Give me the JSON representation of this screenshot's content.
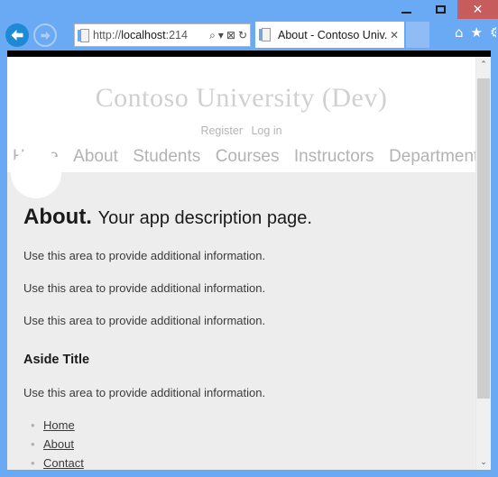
{
  "window": {
    "minimize_label": "Minimize",
    "maximize_label": "Maximize",
    "close_label": "✕"
  },
  "browser": {
    "back_label": "←",
    "forward_label": "→",
    "address": {
      "url_scheme": "http://",
      "url_host": "localhost",
      "url_port": ":214",
      "search_icon": "⌕",
      "dropdown_icon": "▾",
      "compat_icon": "⊠",
      "refresh_icon": "↻"
    },
    "tab": {
      "title": "About - Contoso Univ...",
      "close_label": "✕"
    },
    "toolbar_icons": {
      "home": "⌂",
      "favorites": "★",
      "tools": "⚙"
    }
  },
  "site": {
    "brand": "Contoso University (Dev)",
    "auth_links": [
      {
        "label": "Register"
      },
      {
        "label": "Log in"
      }
    ],
    "nav": [
      {
        "label": "Home"
      },
      {
        "label": "About"
      },
      {
        "label": "Students"
      },
      {
        "label": "Courses"
      },
      {
        "label": "Instructors"
      },
      {
        "label": "Departments"
      }
    ]
  },
  "page": {
    "heading_bold": "About.",
    "heading_sub": "Your app description page.",
    "paragraphs": [
      "Use this area to provide additional information.",
      "Use this area to provide additional information.",
      "Use this area to provide additional information."
    ],
    "aside_title": "Aside Title",
    "aside_text": "Use this area to provide additional information.",
    "links": [
      {
        "label": "Home"
      },
      {
        "label": "About"
      },
      {
        "label": "Contact"
      }
    ]
  },
  "scrollbar": {
    "up_arrow": "⌃",
    "down_arrow": "⌄"
  }
}
